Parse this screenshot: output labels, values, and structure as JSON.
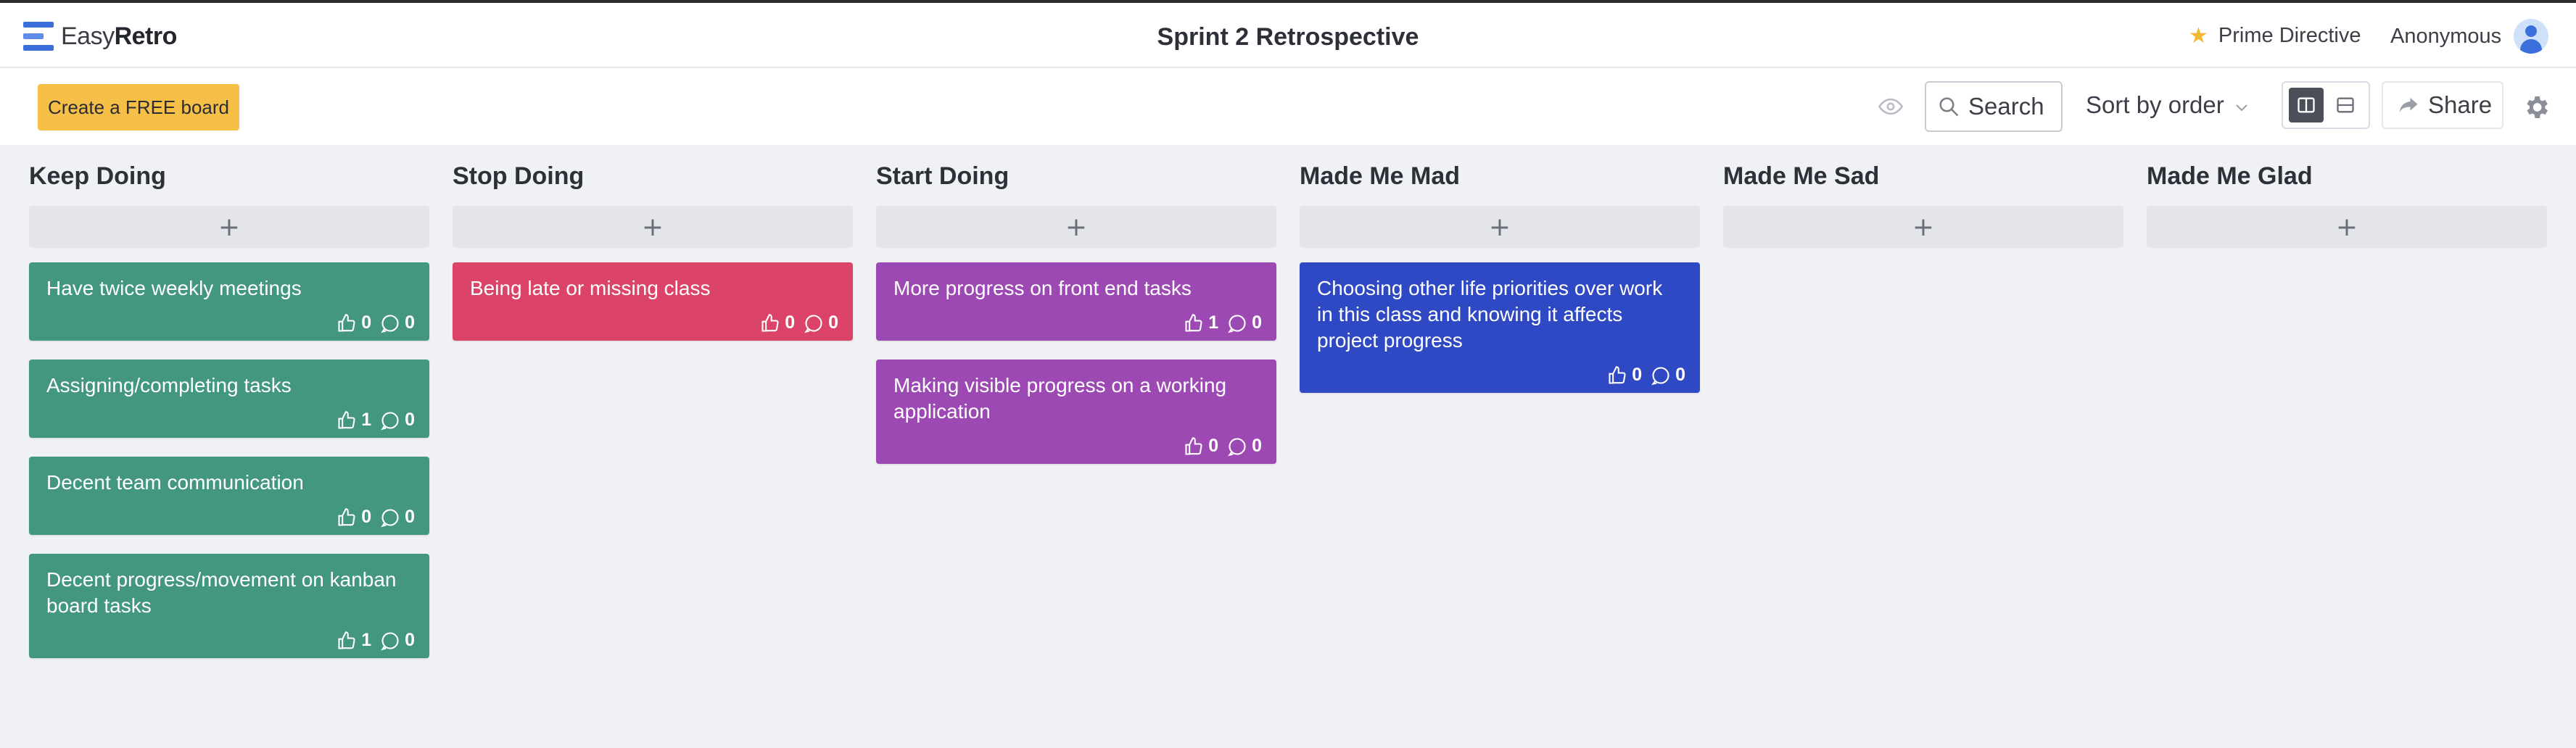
{
  "app": {
    "logo_light": "Easy",
    "logo_bold": "Retro"
  },
  "header": {
    "board_title": "Sprint 2 Retrospective",
    "prime_directive": "Prime Directive",
    "user_name": "Anonymous"
  },
  "toolbar": {
    "create_label": "Create a FREE board",
    "search_label": "Search",
    "sort_label": "Sort by order",
    "share_label": "Share"
  },
  "colors": {
    "keep": "#43967f",
    "stop": "#dc4368",
    "start": "#9d49b3",
    "mad": "#2f48c3",
    "create_button": "#f6bf47"
  },
  "columns": [
    {
      "title": "Keep Doing",
      "add_label": "+",
      "color_key": "keep",
      "cards": [
        {
          "text": "Have twice weekly meetings",
          "likes": "0",
          "comments": "0"
        },
        {
          "text": "Assigning/completing tasks",
          "likes": "1",
          "comments": "0"
        },
        {
          "text": "Decent team communication",
          "likes": "0",
          "comments": "0"
        },
        {
          "text": "Decent progress/movement on kanban board tasks",
          "likes": "1",
          "comments": "0"
        }
      ]
    },
    {
      "title": "Stop Doing",
      "add_label": "+",
      "color_key": "stop",
      "cards": [
        {
          "text": "Being late or missing class",
          "likes": "0",
          "comments": "0"
        }
      ]
    },
    {
      "title": "Start Doing",
      "add_label": "+",
      "color_key": "start",
      "cards": [
        {
          "text": "More progress on front end tasks",
          "likes": "1",
          "comments": "0"
        },
        {
          "text": "Making visible progress on a working application",
          "likes": "0",
          "comments": "0"
        }
      ]
    },
    {
      "title": "Made Me Mad",
      "add_label": "+",
      "color_key": "mad",
      "cards": [
        {
          "text": "Choosing other life priorities over work in this class and knowing it affects project progress",
          "likes": "0",
          "comments": "0"
        }
      ]
    },
    {
      "title": "Made Me Sad",
      "add_label": "+",
      "color_key": "sad",
      "cards": []
    },
    {
      "title": "Made Me Glad",
      "add_label": "+",
      "color_key": "glad",
      "cards": []
    }
  ]
}
